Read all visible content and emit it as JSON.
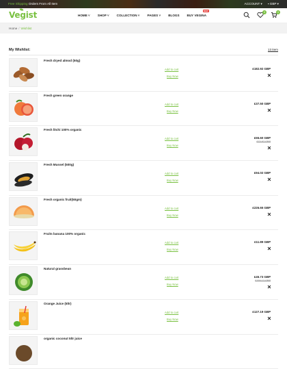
{
  "topbar": {
    "promo_accent": "Free Shipping",
    "promo_rest": "Orders From All Item",
    "account": "ACCOUNT",
    "currency": "GBP"
  },
  "header": {
    "logo": "Vegist",
    "nav": [
      {
        "label": "HOME",
        "dropdown": true
      },
      {
        "label": "SHOP",
        "dropdown": true
      },
      {
        "label": "COLLECTION",
        "dropdown": true
      },
      {
        "label": "PAGES",
        "dropdown": true
      },
      {
        "label": "BLOGS",
        "dropdown": false
      },
      {
        "label": "BUY VEGINA",
        "dropdown": false,
        "badge": "NEW"
      }
    ],
    "wishlist_count": "0",
    "cart_count": "0"
  },
  "breadcrumb": {
    "home": "Home",
    "current": "Wishlist"
  },
  "wishlist": {
    "title": "My Wishlist:",
    "count_label": "13 item",
    "add_to_cart_label": "Add to cart",
    "buy_now_label": "Buy Now",
    "items": [
      {
        "name": "Fresh dryed almod (50g)",
        "price": "£182.92 GBP",
        "old_price": "",
        "icon": "almond"
      },
      {
        "name": "Fresh green orange",
        "price": "£37.50 GBP",
        "old_price": "",
        "icon": "orange"
      },
      {
        "name": "Fresh litchi 100% organic",
        "price": "£55.60 GBP",
        "old_price": "£73.87 GBP",
        "icon": "litchi"
      },
      {
        "name": "Fresh Mussel (500g)",
        "price": "£94.02 GBP",
        "old_price": "",
        "icon": "mussel"
      },
      {
        "name": "Fresh organic fruit(50gm)",
        "price": "£226.65 GBP",
        "old_price": "",
        "icon": "melon"
      },
      {
        "name": "Fruits banana 100% organic",
        "price": "£11.89 GBP",
        "old_price": "",
        "icon": "banana"
      },
      {
        "name": "Natural grassbean",
        "price": "£45.73 GBP",
        "old_price": "£159.12 GBP",
        "icon": "cabbage"
      },
      {
        "name": "Orange Juice (5ltr)",
        "price": "£127.19 GBP",
        "old_price": "",
        "icon": "juice"
      },
      {
        "name": "organic coconut 5ltr juice",
        "price": "",
        "old_price": "",
        "icon": "coconut"
      }
    ]
  },
  "colors": {
    "accent": "#7ac142",
    "remove": "#222222",
    "badge_new": "#e53935"
  }
}
